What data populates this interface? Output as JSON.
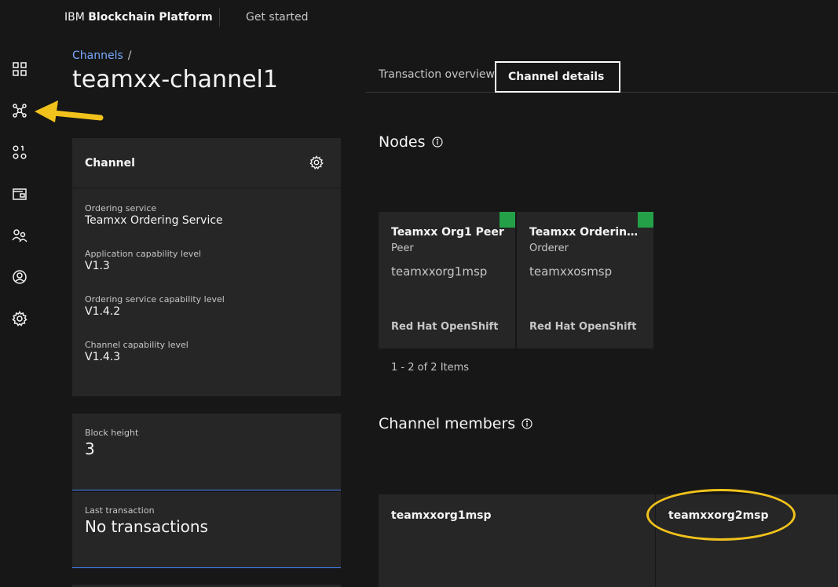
{
  "header": {
    "brand_prefix": "IBM",
    "brand_name": "Blockchain Platform",
    "get_started": "Get started"
  },
  "rail": {
    "icons": [
      "dashboard-icon",
      "channels-icon",
      "identities-icon",
      "wallet-icon",
      "users-icon",
      "account-icon",
      "settings-icon"
    ],
    "active": "channels-icon"
  },
  "breadcrumb": {
    "link": "Channels",
    "separator": "/"
  },
  "page_title": "teamxx-channel1",
  "channel_card": {
    "title": "Channel",
    "fields": [
      {
        "label": "Ordering service",
        "value": "Teamxx Ordering Service"
      },
      {
        "label": "Application capability level",
        "value": "V1.3"
      },
      {
        "label": "Ordering service capability level",
        "value": "V1.4.2"
      },
      {
        "label": "Channel capability level",
        "value": "V1.4.3"
      }
    ]
  },
  "block_card": {
    "label": "Block height",
    "value": "3"
  },
  "last_tx_card": {
    "label": "Last transaction",
    "value": "No transactions"
  },
  "tabs": {
    "overview": "Transaction overview",
    "details": "Channel details",
    "selected": "details"
  },
  "nodes": {
    "title": "Nodes",
    "items": [
      {
        "name": "Teamxx Org1 Peer",
        "type": "Peer",
        "msp": "teamxxorg1msp",
        "platform": "Red Hat OpenShift",
        "status_color": "#24a148"
      },
      {
        "name": "Teamxx Ordering Service",
        "type": "Orderer",
        "msp": "teamxxosmsp",
        "platform": "Red Hat OpenShift",
        "status_color": "#24a148"
      }
    ],
    "pagination": "1 - 2 of 2 Items"
  },
  "members": {
    "title": "Channel members",
    "items": [
      {
        "name": "teamxxorg1msp"
      },
      {
        "name": "teamxxorg2msp"
      }
    ]
  },
  "colors": {
    "accent_link": "#78a9ff",
    "status_ok": "#24a148",
    "annotation": "#f1c21b"
  }
}
